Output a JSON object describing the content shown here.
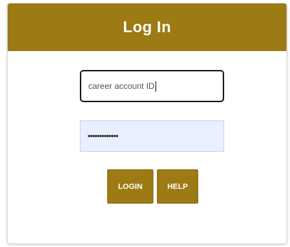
{
  "login": {
    "title": "Log In",
    "username": {
      "value": "career account ID"
    },
    "password": {
      "masked_value": "•••••••••••••"
    },
    "buttons": {
      "login_label": "LOGIN",
      "help_label": "HELP"
    }
  },
  "colors": {
    "brand": "#9c7a14",
    "autofill_background": "#e8f0fe",
    "button_text": "#ffffff"
  }
}
